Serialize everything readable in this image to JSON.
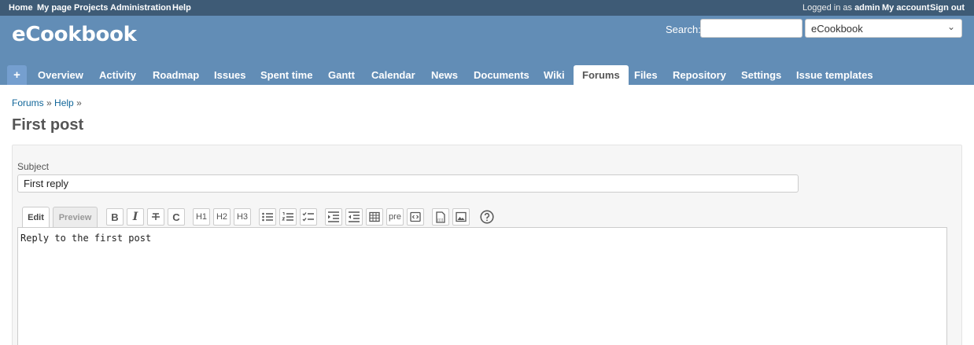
{
  "top_menu": {
    "links": [
      "Home",
      "My page",
      "Projects",
      "Administration",
      "Help"
    ],
    "logged_in_prefix": "Logged in as",
    "user": "admin",
    "my_account": "My account",
    "sign_out": "Sign out"
  },
  "header": {
    "title": "eCookbook",
    "search_label": "Search:",
    "search_value": "",
    "project_selected": "eCookbook"
  },
  "main_menu": {
    "new_object": "+",
    "tabs": [
      "Overview",
      "Activity",
      "Roadmap",
      "Issues",
      "Spent time",
      "Gantt",
      "Calendar",
      "News",
      "Documents",
      "Wiki",
      "Forums",
      "Files",
      "Repository",
      "Settings",
      "Issue templates"
    ],
    "selected": "Forums"
  },
  "breadcrumb": {
    "items": [
      "Forums",
      "Help"
    ],
    "separator": "»"
  },
  "page_title": "First post",
  "form": {
    "subject_label": "Subject",
    "subject_value": "First reply",
    "tab_edit": "Edit",
    "tab_preview": "Preview",
    "toolbar": {
      "bold": "B",
      "italic": "I",
      "code": "C",
      "h1": "H1",
      "h2": "H2",
      "h3": "H3",
      "pre": "pre"
    },
    "content": "Reply to the first post"
  },
  "colors": {
    "top_bar": "#3e5b76",
    "header": "#628db6",
    "link": "#116699"
  }
}
